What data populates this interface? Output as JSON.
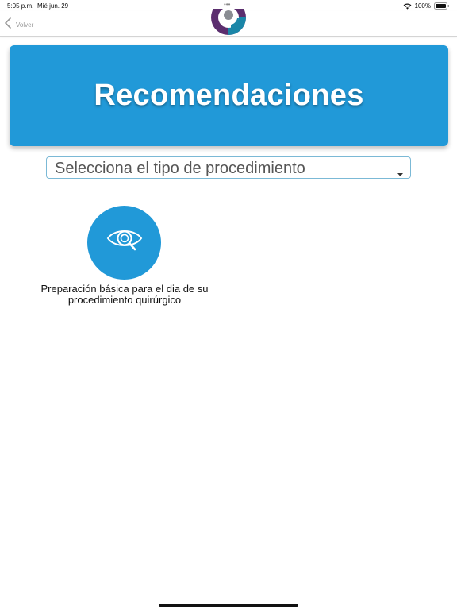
{
  "status_bar": {
    "time": "5:05 p.m.",
    "date": "Mié jun. 29",
    "battery": "100%",
    "multitask_dots": "•••"
  },
  "nav": {
    "back_label": "Volver",
    "logo": "clinic-logo"
  },
  "header": {
    "title": "Recomendaciones",
    "background_color": "#2199d8"
  },
  "procedure_select": {
    "value": "Selecciona el tipo de procedimiento"
  },
  "recommendations": [
    {
      "icon": "eye-search-icon",
      "label": "Preparación básica para el dia de su procedimiento quirúrgico"
    }
  ],
  "colors": {
    "accent": "#2199d8",
    "logo_purple": "#5b2e6e",
    "logo_teal": "#1a86a8"
  }
}
